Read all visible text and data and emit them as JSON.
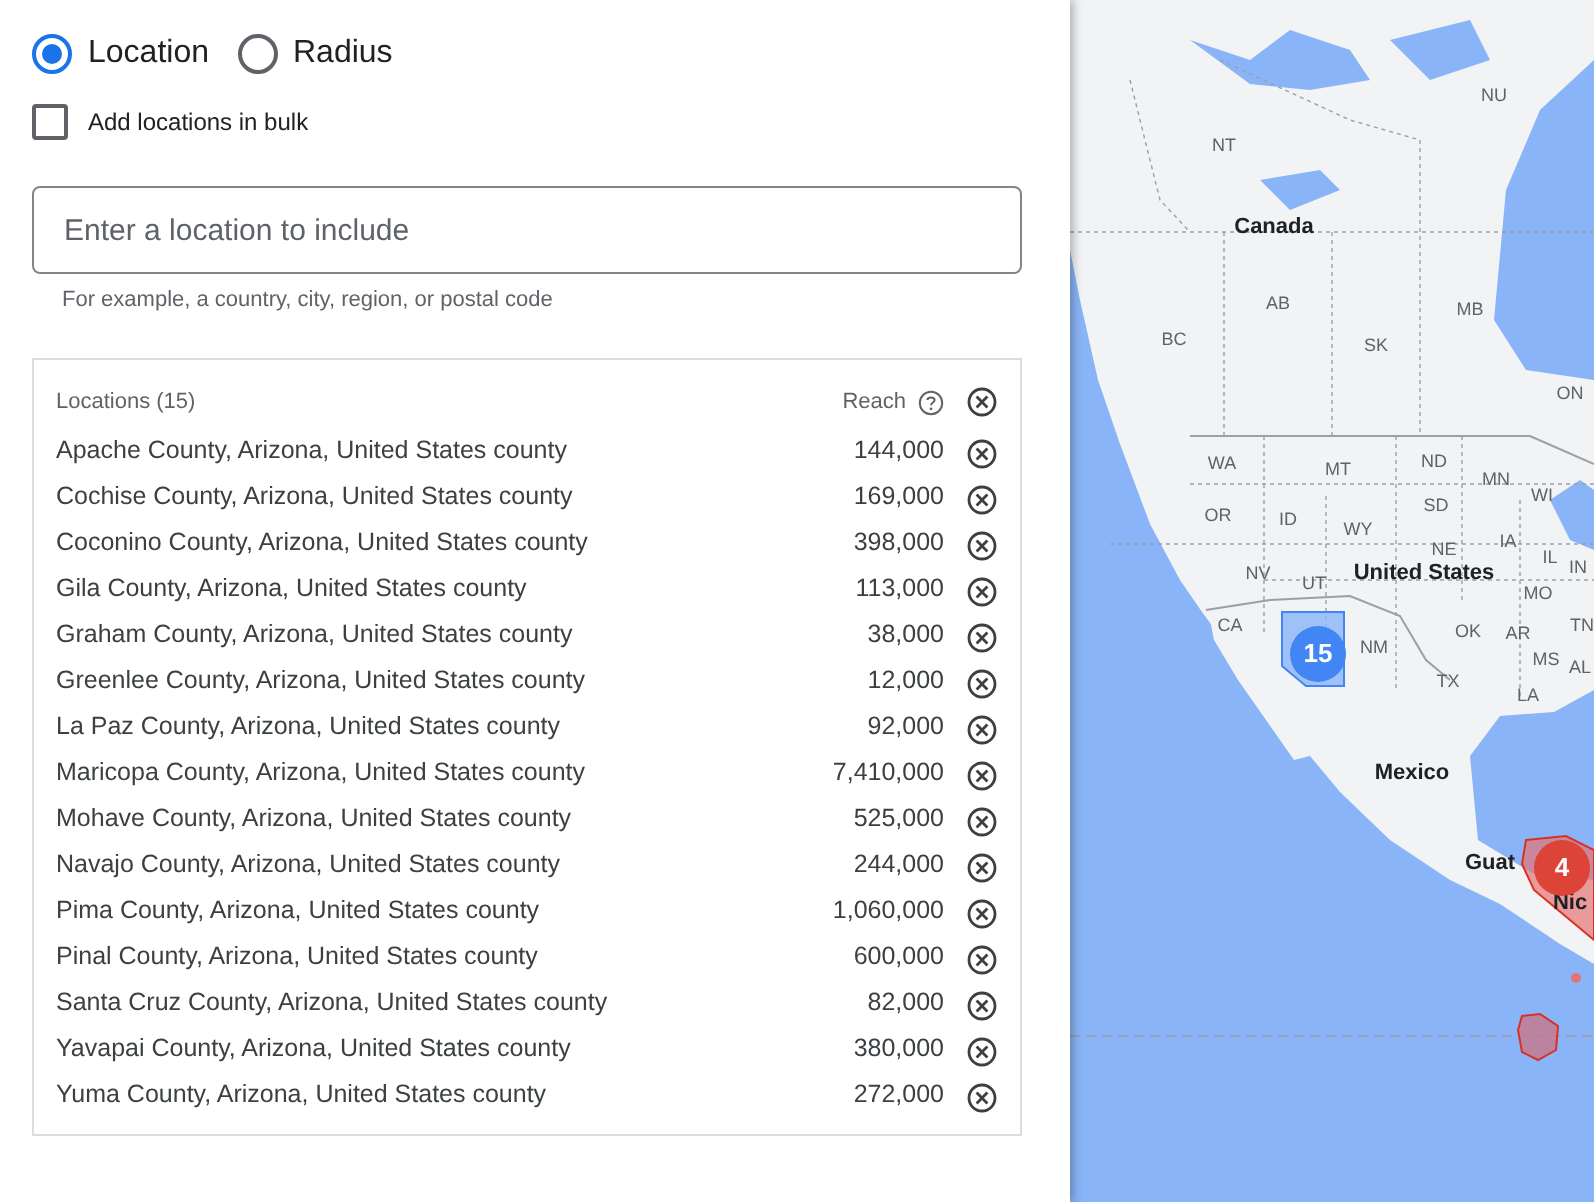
{
  "targeting_options": [
    {
      "label": "Location",
      "selected": true
    },
    {
      "label": "Radius",
      "selected": false
    }
  ],
  "bulk_checkbox": {
    "label": "Add locations in bulk",
    "checked": false
  },
  "location_search": {
    "placeholder": "Enter a location to include",
    "hint": "For example, a country, city, region, or postal code"
  },
  "locations_table": {
    "title": "Locations (15)",
    "reach_header": "Reach",
    "rows": [
      {
        "name": "Apache County, Arizona, United States county",
        "reach": "144,000"
      },
      {
        "name": "Cochise County, Arizona, United States county",
        "reach": "169,000"
      },
      {
        "name": "Coconino County, Arizona, United States county",
        "reach": "398,000"
      },
      {
        "name": "Gila County, Arizona, United States county",
        "reach": "113,000"
      },
      {
        "name": "Graham County, Arizona, United States county",
        "reach": "38,000"
      },
      {
        "name": "Greenlee County, Arizona, United States county",
        "reach": "12,000"
      },
      {
        "name": "La Paz County, Arizona, United States county",
        "reach": "92,000"
      },
      {
        "name": "Maricopa County, Arizona, United States county",
        "reach": "7,410,000"
      },
      {
        "name": "Mohave County, Arizona, United States county",
        "reach": "525,000"
      },
      {
        "name": "Navajo County, Arizona, United States county",
        "reach": "244,000"
      },
      {
        "name": "Pima County, Arizona, United States county",
        "reach": "1,060,000"
      },
      {
        "name": "Pinal County, Arizona, United States county",
        "reach": "600,000"
      },
      {
        "name": "Santa Cruz County, Arizona, United States county",
        "reach": "82,000"
      },
      {
        "name": "Yavapai County, Arizona, United States county",
        "reach": "380,000"
      },
      {
        "name": "Yuma County, Arizona, United States county",
        "reach": "272,000"
      }
    ]
  },
  "map": {
    "labels": [
      {
        "text": "NU",
        "kind": "region"
      },
      {
        "text": "NT",
        "kind": "region"
      },
      {
        "text": "Canada",
        "kind": "country"
      },
      {
        "text": "AB",
        "kind": "region"
      },
      {
        "text": "BC",
        "kind": "region"
      },
      {
        "text": "SK",
        "kind": "region"
      },
      {
        "text": "MB",
        "kind": "region"
      },
      {
        "text": "ON",
        "kind": "region"
      },
      {
        "text": "WA",
        "kind": "region"
      },
      {
        "text": "MT",
        "kind": "region"
      },
      {
        "text": "ND",
        "kind": "region"
      },
      {
        "text": "MN",
        "kind": "region"
      },
      {
        "text": "WI",
        "kind": "region"
      },
      {
        "text": "OR",
        "kind": "region"
      },
      {
        "text": "ID",
        "kind": "region"
      },
      {
        "text": "WY",
        "kind": "region"
      },
      {
        "text": "SD",
        "kind": "region"
      },
      {
        "text": "NE",
        "kind": "region"
      },
      {
        "text": "IA",
        "kind": "region"
      },
      {
        "text": "IL",
        "kind": "region"
      },
      {
        "text": "NV",
        "kind": "region"
      },
      {
        "text": "UT",
        "kind": "region"
      },
      {
        "text": "United States",
        "kind": "country"
      },
      {
        "text": "MO",
        "kind": "region"
      },
      {
        "text": "IN",
        "kind": "region"
      },
      {
        "text": "CA",
        "kind": "region"
      },
      {
        "text": "NM",
        "kind": "region"
      },
      {
        "text": "OK",
        "kind": "region"
      },
      {
        "text": "AR",
        "kind": "region"
      },
      {
        "text": "TN",
        "kind": "region"
      },
      {
        "text": "MS",
        "kind": "region"
      },
      {
        "text": "AL",
        "kind": "region"
      },
      {
        "text": "TX",
        "kind": "region"
      },
      {
        "text": "LA",
        "kind": "region"
      },
      {
        "text": "Mexico",
        "kind": "country"
      },
      {
        "text": "Guat",
        "kind": "country"
      },
      {
        "text": "Nic",
        "kind": "country"
      }
    ],
    "clusters": [
      {
        "count": "15",
        "color": "#4285f4"
      },
      {
        "count": "4",
        "color": "#db4437"
      }
    ]
  }
}
